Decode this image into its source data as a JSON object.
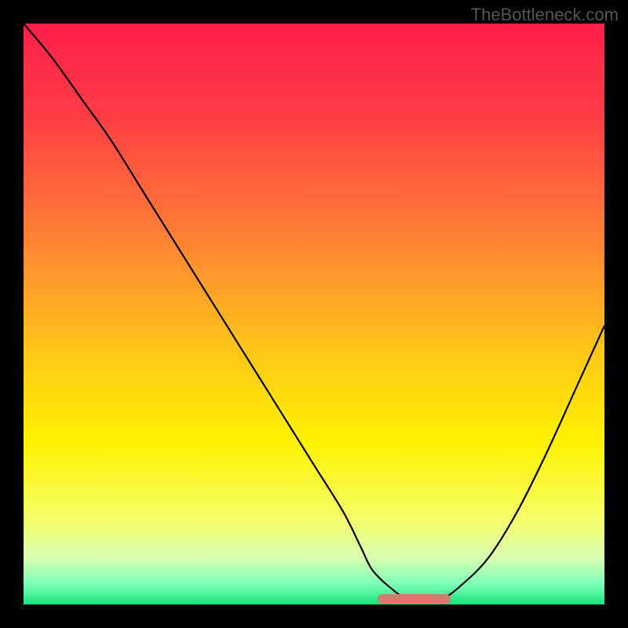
{
  "watermark": "TheBottleneck.com",
  "colors": {
    "gradient_stops": [
      {
        "pos": 0.0,
        "color": "#ff1f4a"
      },
      {
        "pos": 0.15,
        "color": "#ff3a45"
      },
      {
        "pos": 0.35,
        "color": "#ff7a36"
      },
      {
        "pos": 0.55,
        "color": "#ffc21a"
      },
      {
        "pos": 0.72,
        "color": "#fff200"
      },
      {
        "pos": 0.85,
        "color": "#f6ff66"
      },
      {
        "pos": 0.92,
        "color": "#d8ffb0"
      },
      {
        "pos": 0.965,
        "color": "#7dffb8"
      },
      {
        "pos": 1.0,
        "color": "#19e27a"
      }
    ],
    "curve": "#000000",
    "marker": "#da7a6f",
    "frame": "#000000"
  },
  "chart_data": {
    "type": "line",
    "title": "",
    "xlabel": "",
    "ylabel": "",
    "xlim": [
      0,
      100
    ],
    "ylim": [
      0,
      100
    ],
    "series": [
      {
        "name": "bottleneck-curve",
        "x": [
          0,
          5,
          10,
          15,
          20,
          25,
          30,
          35,
          40,
          45,
          50,
          55,
          58,
          60,
          63,
          66,
          69,
          72,
          75,
          80,
          85,
          90,
          95,
          100
        ],
        "y": [
          100,
          94,
          87,
          80,
          72,
          64,
          56,
          48,
          40,
          32,
          24,
          16,
          10,
          6,
          3,
          1,
          1,
          1,
          3,
          8,
          16,
          26,
          37,
          48
        ]
      }
    ],
    "annotations": [
      {
        "name": "optimal-band",
        "x_start": 61,
        "x_end": 73.5,
        "y": 1
      }
    ],
    "grid": false,
    "legend": false
  }
}
